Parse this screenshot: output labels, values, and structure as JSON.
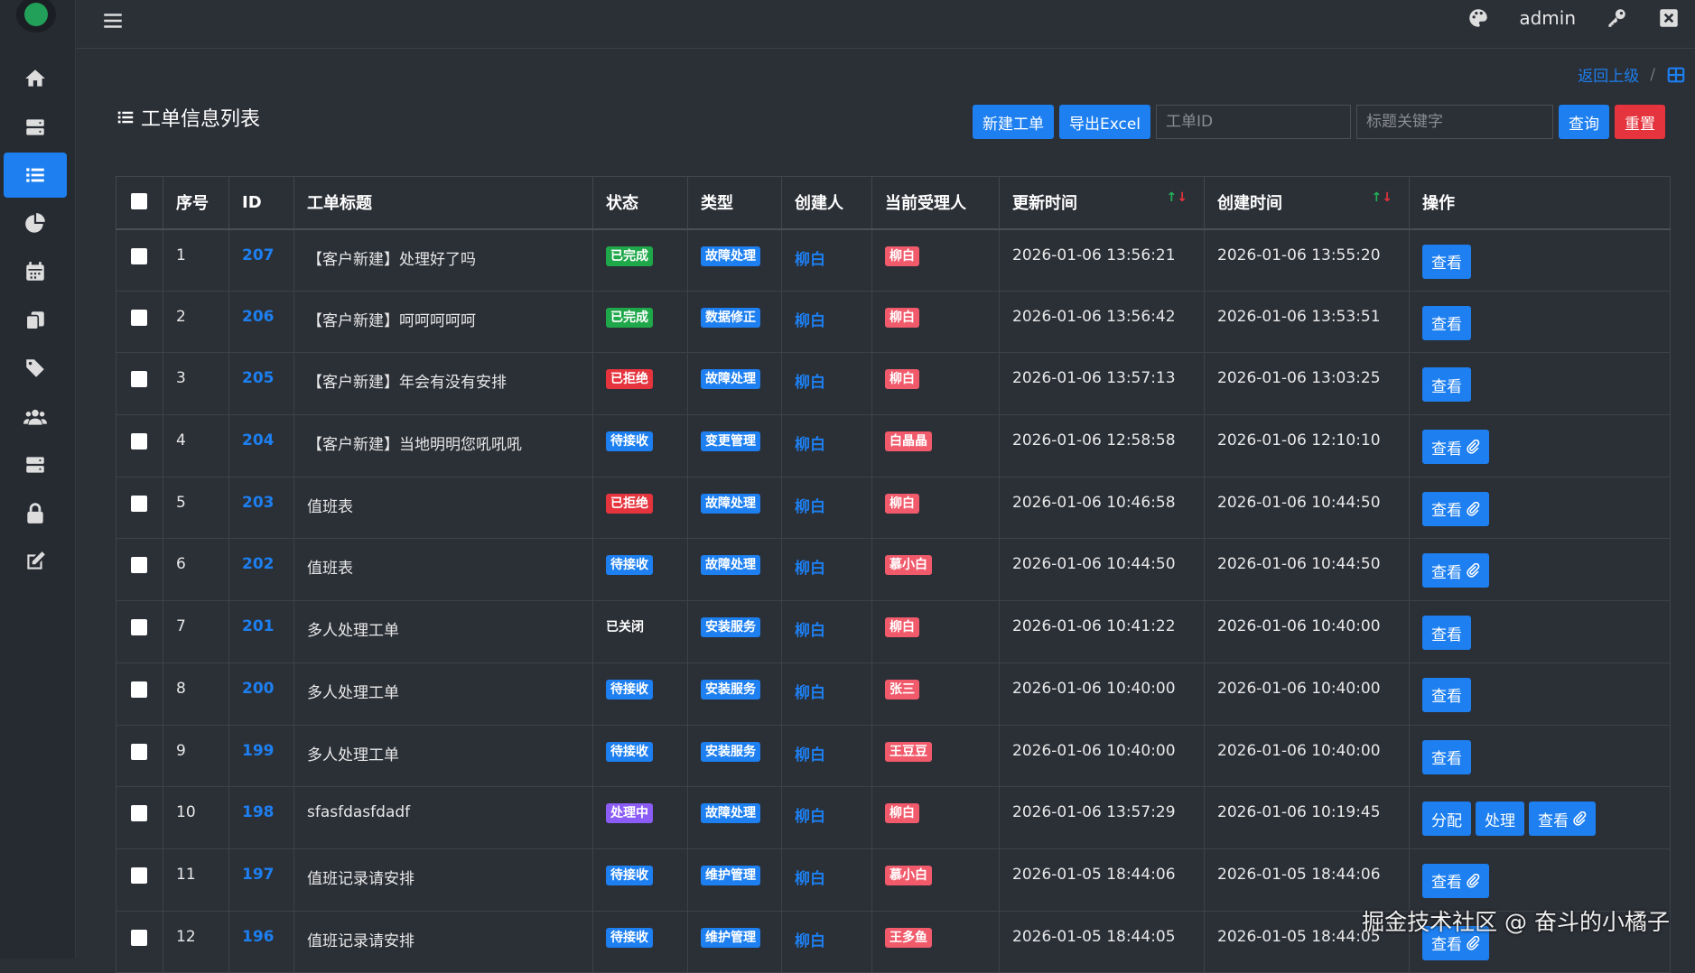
{
  "app": {
    "user": "admin"
  },
  "sidebar": {
    "items": [
      {
        "icon": "home-icon"
      },
      {
        "icon": "server-icon"
      },
      {
        "icon": "list-icon",
        "active": true
      },
      {
        "icon": "pie-chart-icon"
      },
      {
        "icon": "calendar-icon"
      },
      {
        "icon": "copy-icon"
      },
      {
        "icon": "tags-icon"
      },
      {
        "icon": "users-icon"
      },
      {
        "icon": "database-icon"
      },
      {
        "icon": "lock-icon"
      },
      {
        "icon": "edit-icon"
      }
    ]
  },
  "breadcrumb": {
    "back": "返回上级",
    "sep": "/"
  },
  "page": {
    "title": "工单信息列表"
  },
  "toolbar": {
    "new": "新建工单",
    "export": "导出Excel",
    "id_placeholder": "工单ID",
    "kw_placeholder": "标题关键字",
    "query": "查询",
    "reset": "重置"
  },
  "table": {
    "headers": [
      "序号",
      "ID",
      "工单标题",
      "状态",
      "类型",
      "创建人",
      "当前受理人",
      "更新时间",
      "创建时间",
      "操作"
    ],
    "rows": [
      {
        "no": "1",
        "id": "207",
        "title": "【客户新建】处理好了吗",
        "status": "已完成",
        "sc": "green",
        "type": "故障处理",
        "creator": "柳白",
        "assignee": "柳白",
        "updated": "2026-01-06 13:56:21",
        "created": "2026-01-06 13:55:20",
        "ops": [
          {
            "label": "查看",
            "clip": false
          }
        ]
      },
      {
        "no": "2",
        "id": "206",
        "title": "【客户新建】呵呵呵呵呵",
        "status": "已完成",
        "sc": "green",
        "type": "数据修正",
        "creator": "柳白",
        "assignee": "柳白",
        "updated": "2026-01-06 13:56:42",
        "created": "2026-01-06 13:53:51",
        "ops": [
          {
            "label": "查看",
            "clip": false
          }
        ]
      },
      {
        "no": "3",
        "id": "205",
        "title": "【客户新建】年会有没有安排",
        "status": "已拒绝",
        "sc": "red",
        "type": "故障处理",
        "creator": "柳白",
        "assignee": "柳白",
        "updated": "2026-01-06 13:57:13",
        "created": "2026-01-06 13:03:25",
        "ops": [
          {
            "label": "查看",
            "clip": false
          }
        ]
      },
      {
        "no": "4",
        "id": "204",
        "title": "【客户新建】当地明明您吼吼吼",
        "status": "待接收",
        "sc": "blue",
        "type": "变更管理",
        "creator": "柳白",
        "assignee": "白晶晶",
        "updated": "2026-01-06 12:58:58",
        "created": "2026-01-06 12:10:10",
        "ops": [
          {
            "label": "查看",
            "clip": true
          }
        ]
      },
      {
        "no": "5",
        "id": "203",
        "title": "值班表",
        "status": "已拒绝",
        "sc": "red",
        "type": "故障处理",
        "creator": "柳白",
        "assignee": "柳白",
        "updated": "2026-01-06 10:46:58",
        "created": "2026-01-06 10:44:50",
        "ops": [
          {
            "label": "查看",
            "clip": true
          }
        ]
      },
      {
        "no": "6",
        "id": "202",
        "title": "值班表",
        "status": "待接收",
        "sc": "blue",
        "type": "故障处理",
        "creator": "柳白",
        "assignee": "慕小白",
        "updated": "2026-01-06 10:44:50",
        "created": "2026-01-06 10:44:50",
        "ops": [
          {
            "label": "查看",
            "clip": true
          }
        ]
      },
      {
        "no": "7",
        "id": "201",
        "title": "多人处理工单",
        "status": "已关闭",
        "sc": "closed",
        "type": "安装服务",
        "creator": "柳白",
        "assignee": "柳白",
        "updated": "2026-01-06 10:41:22",
        "created": "2026-01-06 10:40:00",
        "ops": [
          {
            "label": "查看",
            "clip": false
          }
        ]
      },
      {
        "no": "8",
        "id": "200",
        "title": "多人处理工单",
        "status": "待接收",
        "sc": "blue",
        "type": "安装服务",
        "creator": "柳白",
        "assignee": "张三",
        "updated": "2026-01-06 10:40:00",
        "created": "2026-01-06 10:40:00",
        "ops": [
          {
            "label": "查看",
            "clip": false
          }
        ]
      },
      {
        "no": "9",
        "id": "199",
        "title": "多人处理工单",
        "status": "待接收",
        "sc": "blue",
        "type": "安装服务",
        "creator": "柳白",
        "assignee": "王豆豆",
        "updated": "2026-01-06 10:40:00",
        "created": "2026-01-06 10:40:00",
        "ops": [
          {
            "label": "查看",
            "clip": false
          }
        ]
      },
      {
        "no": "10",
        "id": "198",
        "title": "sfasfdasfdadf",
        "status": "处理中",
        "sc": "purple",
        "type": "故障处理",
        "creator": "柳白",
        "assignee": "柳白",
        "updated": "2026-01-06 13:57:29",
        "created": "2026-01-06 10:19:45",
        "ops": [
          {
            "label": "分配",
            "clip": false
          },
          {
            "label": "处理",
            "clip": false
          },
          {
            "label": "查看",
            "clip": true
          }
        ]
      },
      {
        "no": "11",
        "id": "197",
        "title": "值班记录请安排",
        "status": "待接收",
        "sc": "blue",
        "type": "维护管理",
        "creator": "柳白",
        "assignee": "慕小白",
        "updated": "2026-01-05 18:44:06",
        "created": "2026-01-05 18:44:06",
        "ops": [
          {
            "label": "查看",
            "clip": true
          }
        ]
      },
      {
        "no": "12",
        "id": "196",
        "title": "值班记录请安排",
        "status": "待接收",
        "sc": "blue",
        "type": "维护管理",
        "creator": "柳白",
        "assignee": "王多鱼",
        "updated": "2026-01-05 18:44:05",
        "created": "2026-01-05 18:44:05",
        "ops": [
          {
            "label": "查看",
            "clip": true
          }
        ]
      }
    ]
  },
  "watermark": "掘金技术社区 @ 奋斗的小橘子"
}
